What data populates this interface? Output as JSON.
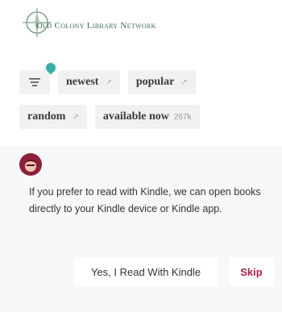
{
  "header": {
    "logo_text": "Old Colony Library Network",
    "logo_icon": "compass-logo-icon"
  },
  "filters": {
    "menu_icon": "hamburger-menu-icon",
    "items": [
      {
        "label": "newest",
        "icon": "arrow-icon"
      },
      {
        "label": "popular",
        "icon": "arrow-icon"
      },
      {
        "label": "random",
        "icon": "arrow-icon"
      },
      {
        "label": "available now",
        "count": "267k"
      }
    ]
  },
  "prompt": {
    "avatar_icon": "character-avatar-icon",
    "message": "If you prefer to read with Kindle, we can open books directly to your Kindle device or Kindle app.",
    "confirm_label": "Yes, I Read With Kindle",
    "skip_label": "Skip"
  },
  "colors": {
    "accent": "#b0224a",
    "dot": "#36b1a4",
    "logo": "#35704f",
    "avatar": "#8c1f3b"
  }
}
